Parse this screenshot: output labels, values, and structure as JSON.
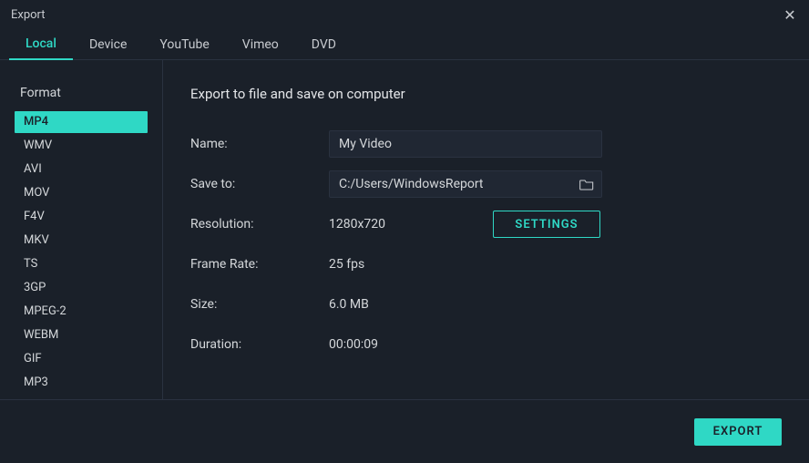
{
  "window": {
    "title": "Export"
  },
  "tabs": [
    {
      "label": "Local",
      "active": true
    },
    {
      "label": "Device",
      "active": false
    },
    {
      "label": "YouTube",
      "active": false
    },
    {
      "label": "Vimeo",
      "active": false
    },
    {
      "label": "DVD",
      "active": false
    }
  ],
  "sidebar": {
    "heading": "Format",
    "items": [
      {
        "label": "MP4",
        "active": true
      },
      {
        "label": "WMV",
        "active": false
      },
      {
        "label": "AVI",
        "active": false
      },
      {
        "label": "MOV",
        "active": false
      },
      {
        "label": "F4V",
        "active": false
      },
      {
        "label": "MKV",
        "active": false
      },
      {
        "label": "TS",
        "active": false
      },
      {
        "label": "3GP",
        "active": false
      },
      {
        "label": "MPEG-2",
        "active": false
      },
      {
        "label": "WEBM",
        "active": false
      },
      {
        "label": "GIF",
        "active": false
      },
      {
        "label": "MP3",
        "active": false
      }
    ]
  },
  "main": {
    "heading": "Export to file and save on computer",
    "name_label": "Name:",
    "name_value": "My Video",
    "saveto_label": "Save to:",
    "saveto_value": "C:/Users/WindowsReport",
    "resolution_label": "Resolution:",
    "resolution_value": "1280x720",
    "settings_label": "SETTINGS",
    "framerate_label": "Frame Rate:",
    "framerate_value": "25 fps",
    "size_label": "Size:",
    "size_value": "6.0 MB",
    "duration_label": "Duration:",
    "duration_value": "00:00:09"
  },
  "footer": {
    "export_label": "EXPORT"
  },
  "colors": {
    "accent": "#2fd8c5",
    "bg": "#1a2029",
    "panel": "#202733",
    "border": "#2a3240",
    "text": "#d4d7da"
  }
}
